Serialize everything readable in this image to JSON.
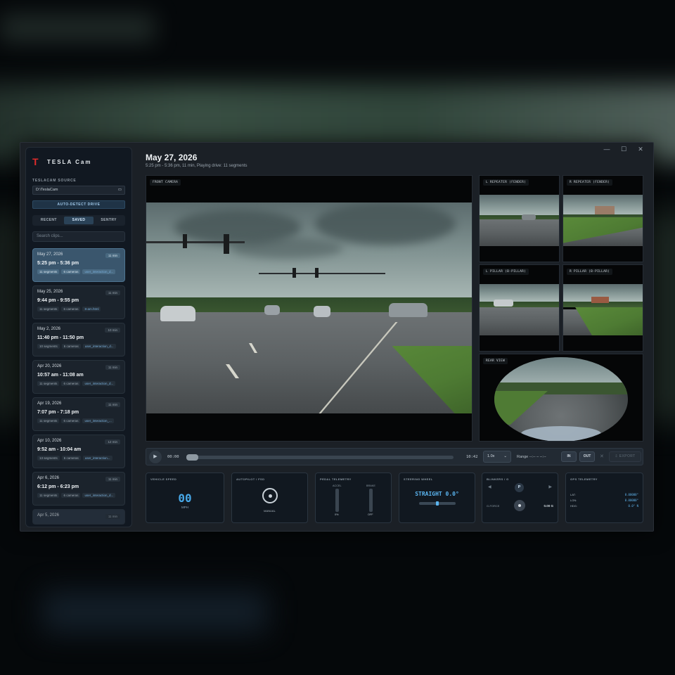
{
  "app": {
    "brand": "TESLA Cam"
  },
  "window_controls": {
    "minimize": "—",
    "maximize": "☐",
    "close": "✕"
  },
  "sidebar": {
    "source_label": "TESLACAM SOURCE",
    "source_path": "D:\\TeslaCam",
    "auto_detect": "AUTO-DETECT DRIVE",
    "tabs": [
      {
        "label": "RECENT",
        "active": false
      },
      {
        "label": "SAVED",
        "active": true
      },
      {
        "label": "SENTRY",
        "active": false
      }
    ],
    "search_placeholder": "Search clips...",
    "clips": [
      {
        "date": "May 27, 2026",
        "duration": "11 min",
        "time": "5:25 pm - 5:36 pm",
        "segments": "11 segments",
        "cameras": "6 cameras",
        "event": "user_interaction_d..."
      },
      {
        "date": "May 25, 2026",
        "duration": "11 min",
        "time": "9:44 pm - 9:55 pm",
        "segments": "11 segments",
        "cameras": "6 cameras",
        "event": "8-am.html"
      },
      {
        "date": "May 2, 2026",
        "duration": "10 min",
        "time": "11:40 pm - 11:50 pm",
        "segments": "10 segments",
        "cameras": "6 cameras",
        "event": "user_interaction_d..."
      },
      {
        "date": "Apr 20, 2026",
        "duration": "11 min",
        "time": "10:57 am - 11:08 am",
        "segments": "11 segments",
        "cameras": "6 cameras",
        "event": "user_interaction_d..."
      },
      {
        "date": "Apr 19, 2026",
        "duration": "11 min",
        "time": "7:07 pm - 7:18 pm",
        "segments": "11 segments",
        "cameras": "6 cameras",
        "event": "user_interaction_..."
      },
      {
        "date": "Apr 10, 2026",
        "duration": "12 min",
        "time": "9:52 am - 10:04 am",
        "segments": "13 segments",
        "cameras": "6 cameras",
        "event": "user_interaction..."
      },
      {
        "date": "Apr 6, 2026",
        "duration": "11 min",
        "time": "6:12 pm - 6:23 pm",
        "segments": "11 segments",
        "cameras": "6 cameras",
        "event": "user_interaction_d..."
      },
      {
        "date": "Apr 5, 2026",
        "duration": "11 min"
      }
    ]
  },
  "header": {
    "title": "May 27, 2026",
    "subtitle": "5:25 pm - 5:36 pm, 11 min, Playing drive: 11 segments"
  },
  "cameras": {
    "front": "FRONT CAMERA",
    "l_repeater": "L REPEATER (FENDER)",
    "r_repeater": "R REPEATER (FENDER)",
    "l_pillar": "L PILLAR (B-PILLAR)",
    "r_pillar": "R PILLAR (B-PILLAR)",
    "rear": "REAR VIEW"
  },
  "controls": {
    "play_icon": "▶",
    "current_time": "00:00",
    "end_time": "10:42",
    "progress": 0,
    "speed": "1.0x",
    "speed_chevron": "⌄",
    "range_label": "Range  --:-- – --:--",
    "in": "IN",
    "out": "OUT",
    "clear": "✕",
    "export": "⇩ EXPORT"
  },
  "telemetry": {
    "speed": {
      "title": "VEHICLE SPEED",
      "value": "00",
      "unit": "MPH"
    },
    "autopilot": {
      "title": "AUTOPILOT / FSD",
      "mode": "MANUAL"
    },
    "pedal": {
      "title": "PEDAL TELEMETRY",
      "accel_label": "ACCEL",
      "brake_label": "BRAKE",
      "accel_value": "0%",
      "brake_value": "OFF"
    },
    "steering": {
      "title": "STEERING WHEEL",
      "value": "STRAIGHT 0.0°",
      "angle": 0
    },
    "blinkers": {
      "title": "BLINKERS / G",
      "left": "◀",
      "gear": "P",
      "right": "▶",
      "gforce_label": "G-FORCE",
      "gforce_value": "0.00 G"
    },
    "gps": {
      "title": "GPS TELEMETRY",
      "lat_label": "LAT:",
      "lat": "0.00000°",
      "lon_label": "LON:",
      "lon": "0.00000°",
      "hdg_label": "HDG:",
      "hdg": "0.0° N"
    }
  },
  "colors": {
    "accent": "#47a8e8",
    "brand_red": "#e02b2b",
    "active_clip": "#3a566d"
  }
}
